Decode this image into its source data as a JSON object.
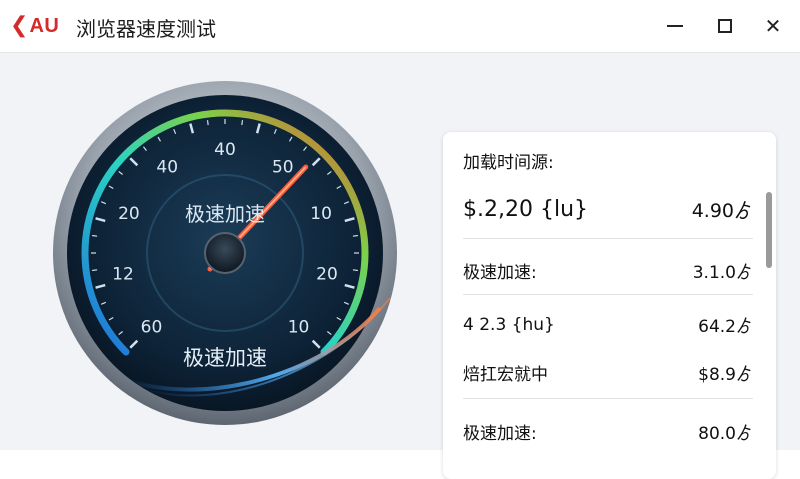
{
  "window": {
    "brand": "AU",
    "title": "浏览器速度测试"
  },
  "gauge": {
    "ticks": [
      "60",
      "12",
      "20",
      "40",
      "40",
      "50",
      "10",
      "20",
      "10"
    ],
    "top_label": "极速加速",
    "bottom_label": "极速加速",
    "needle_level": 0.66,
    "colors": {
      "arc_start": "#1e6fd9",
      "arc_mid": "#2ad3c4",
      "arc_mid2": "#7bd24a",
      "arc_end": "#f0562a",
      "needle": "#ff5a3a",
      "face": "#0d2236"
    }
  },
  "panel": {
    "title": "加载时间源:",
    "rows": [
      {
        "label": "$.2,20 {lu}",
        "value": "4.90ゟ"
      },
      {
        "label": "极速加速:",
        "value": "3.1.0ゟ"
      },
      {
        "label": "4  2.3 {hu}",
        "value": "64.2ゟ"
      },
      {
        "label": "焙扛宏就中",
        "value": "$8.9ゟ"
      },
      {
        "label": "极速加速:",
        "value": "80.0ゟ"
      }
    ]
  }
}
